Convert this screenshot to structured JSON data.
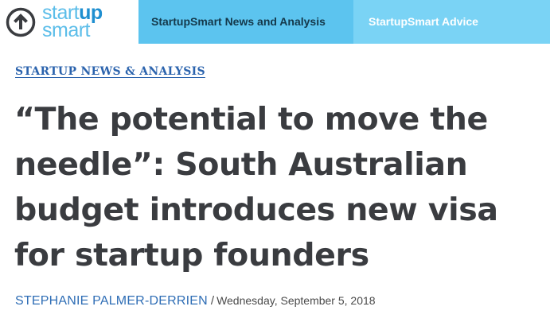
{
  "brand": {
    "name_line1_light": "start",
    "name_line1_bold": "up",
    "name_line2": "smart",
    "colors": {
      "logo_light": "#5bbde9",
      "logo_dark": "#1f8fd0",
      "tab_news": "#5cc4ef",
      "tab_advice": "#7ad3f5",
      "link": "#2b63ad"
    }
  },
  "nav": {
    "tabs": [
      {
        "label": "StartupSmart News and Analysis",
        "active": true
      },
      {
        "label": "StartupSmart Advice",
        "active": false
      }
    ]
  },
  "article": {
    "category": "STARTUP NEWS & ANALYSIS",
    "title": "“The potential to move the needle”: South Australian budget introduces new visa for startup founders",
    "author": "STEPHANIE PALMER-DERRIEN",
    "separator": "/",
    "date": "Wednesday, September 5, 2018"
  }
}
